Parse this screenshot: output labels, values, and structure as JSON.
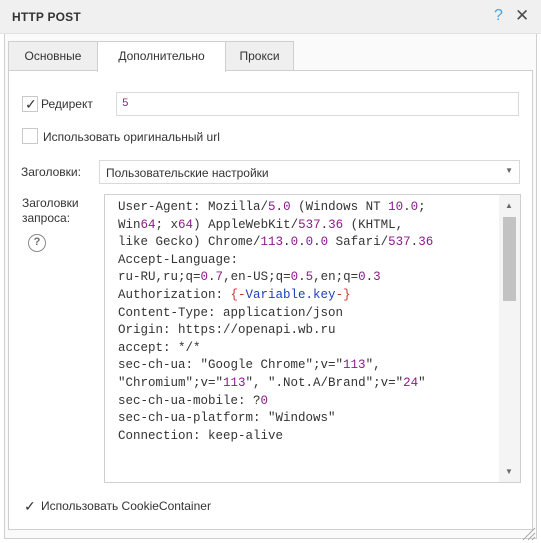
{
  "window": {
    "title": "HTTP POST",
    "help_glyph": "?",
    "close_glyph": "✕"
  },
  "tabs": [
    {
      "label": "Основные",
      "active": false
    },
    {
      "label": "Дополнительно",
      "active": true
    },
    {
      "label": "Прокси",
      "active": false
    }
  ],
  "redirect": {
    "label": "Редирект",
    "checked": true,
    "value": "5"
  },
  "original_url": {
    "label": "Использовать оригинальный url",
    "checked": false
  },
  "headers": {
    "label": "Заголовки:",
    "selected": "Пользовательские настройки"
  },
  "request_headers": {
    "label": "Заголовки запроса:",
    "help_glyph": "?",
    "lines": [
      "User-Agent: Mozilla/5.0 (Windows NT 10.0;",
      "Win64; x64) AppleWebKit/537.36 (KHTML,",
      "like Gecko) Chrome/113.0.0.0 Safari/537.36",
      "Accept-Language:",
      "ru-RU,ru;q=0.7,en-US;q=0.5,en;q=0.3",
      "Authorization: {-Variable.key-}",
      "Content-Type: application/json",
      "Origin: https://openapi.wb.ru",
      "accept: */*",
      "sec-ch-ua: \"Google Chrome\";v=\"113\",",
      "\"Chromium\";v=\"113\", \".Not.A/Brand\";v=\"24\"",
      "sec-ch-ua-mobile: ?0",
      "sec-ch-ua-platform: \"Windows\"",
      "Connection: keep-alive"
    ]
  },
  "cookie_container": {
    "label": "Использовать CookieContainer",
    "checked": true
  },
  "colors": {
    "number": "#8b1a8b",
    "variable": "#1f3fbf",
    "brace": "#c0392b",
    "help": "#49a0e8"
  }
}
